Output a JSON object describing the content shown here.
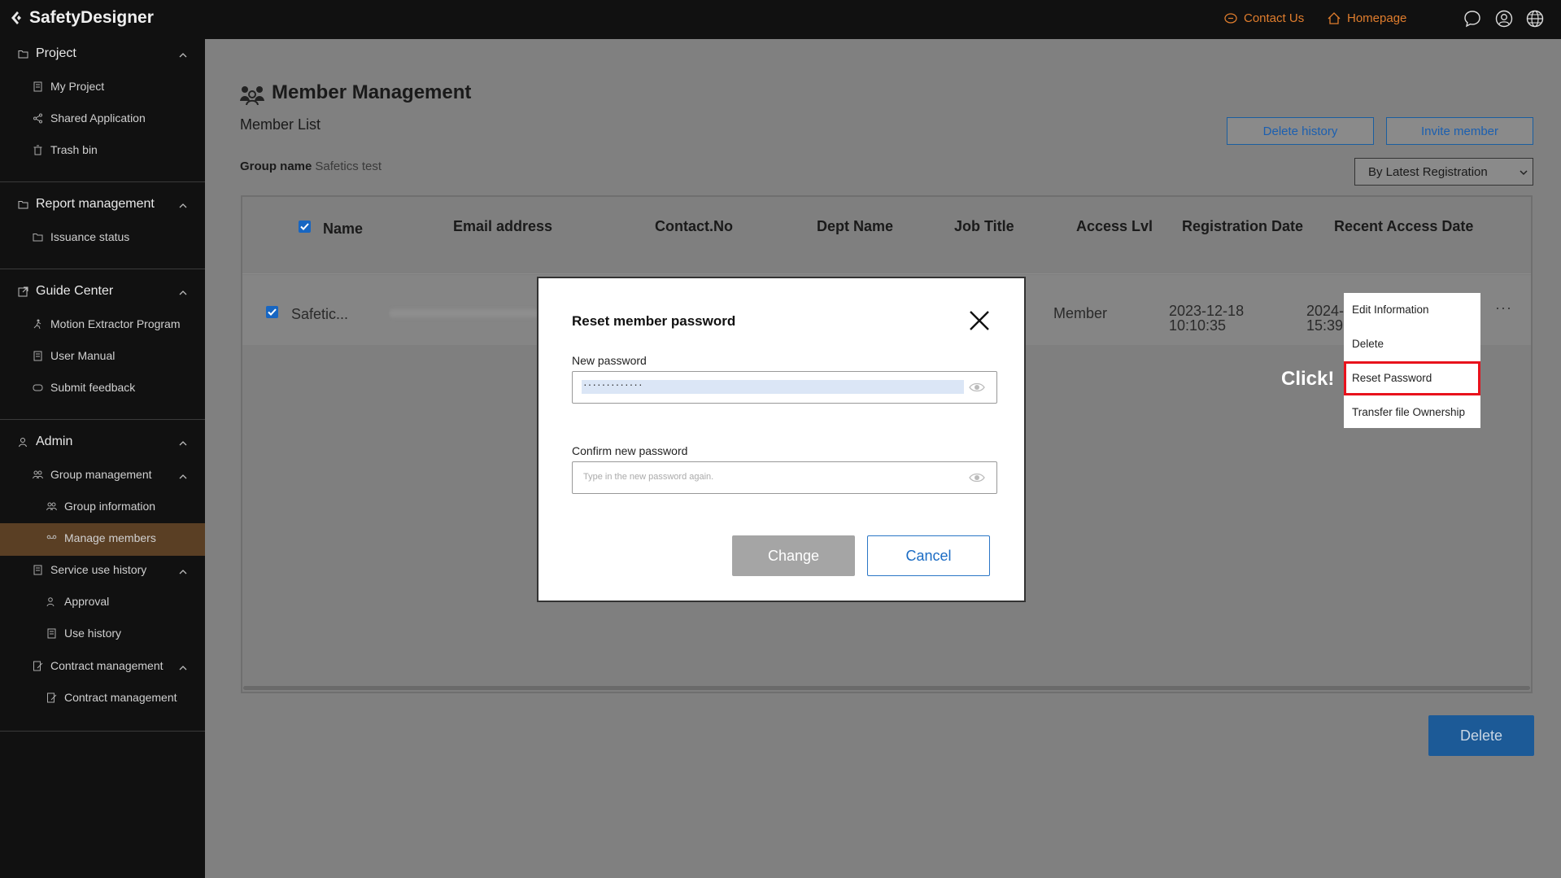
{
  "app": {
    "name": "SafetyDesigner"
  },
  "topbar": {
    "contact_label": "Contact Us",
    "homepage_label": "Homepage",
    "accent": "#e07d2d",
    "icons": [
      "chat-icon",
      "user-icon",
      "globe-icon"
    ]
  },
  "sidebar": {
    "project": {
      "title": "Project",
      "items": [
        "My Project",
        "Shared Application",
        "Trash bin"
      ]
    },
    "report": {
      "title": "Report management",
      "items": [
        "Issuance status"
      ]
    },
    "guide": {
      "title": "Guide Center",
      "items": [
        "Motion Extractor Program",
        "User Manual",
        "Submit feedback"
      ]
    },
    "admin": {
      "title": "Admin",
      "group_mgmt": "Group management",
      "group_info": "Group information",
      "manage_members": "Manage members",
      "service_history": "Service use history",
      "approval": "Approval",
      "use_history": "Use history",
      "contract_mgmt": "Contract management",
      "contract_mgmt_sub": "Contract management"
    },
    "active_color": "#5a3f24"
  },
  "main": {
    "title": "Member Management",
    "list_title": "Member List",
    "group_label": "Group name",
    "group_value": "Safetics test",
    "delete_history_label": "Delete history",
    "invite_member_label": "Invite member",
    "sort_value": "By Latest Registration",
    "delete_label": "Delete",
    "columns": [
      "Name",
      "Email address",
      "Contact.No",
      "Dept Name",
      "Job Title",
      "Access Lvl",
      "Registration Date",
      "Recent Access Date"
    ],
    "row": {
      "name": "Safetic...",
      "access": "Member",
      "reg_date": "2023-12-18",
      "reg_time": "10:10:35",
      "recent_date": "2024-",
      "recent_time": "15:39",
      "more": "···"
    }
  },
  "context_menu": {
    "items": [
      "Edit Information",
      "Delete",
      "Reset Password",
      "Transfer file Ownership"
    ],
    "highlight_color": "#e8121c",
    "annotation": "Click!"
  },
  "modal": {
    "title": "Reset member password",
    "new_password_label": "New password",
    "new_password_value": "·············",
    "confirm_label": "Confirm new password",
    "confirm_placeholder": "Type in the new password again.",
    "change_label": "Change",
    "cancel_label": "Cancel"
  }
}
